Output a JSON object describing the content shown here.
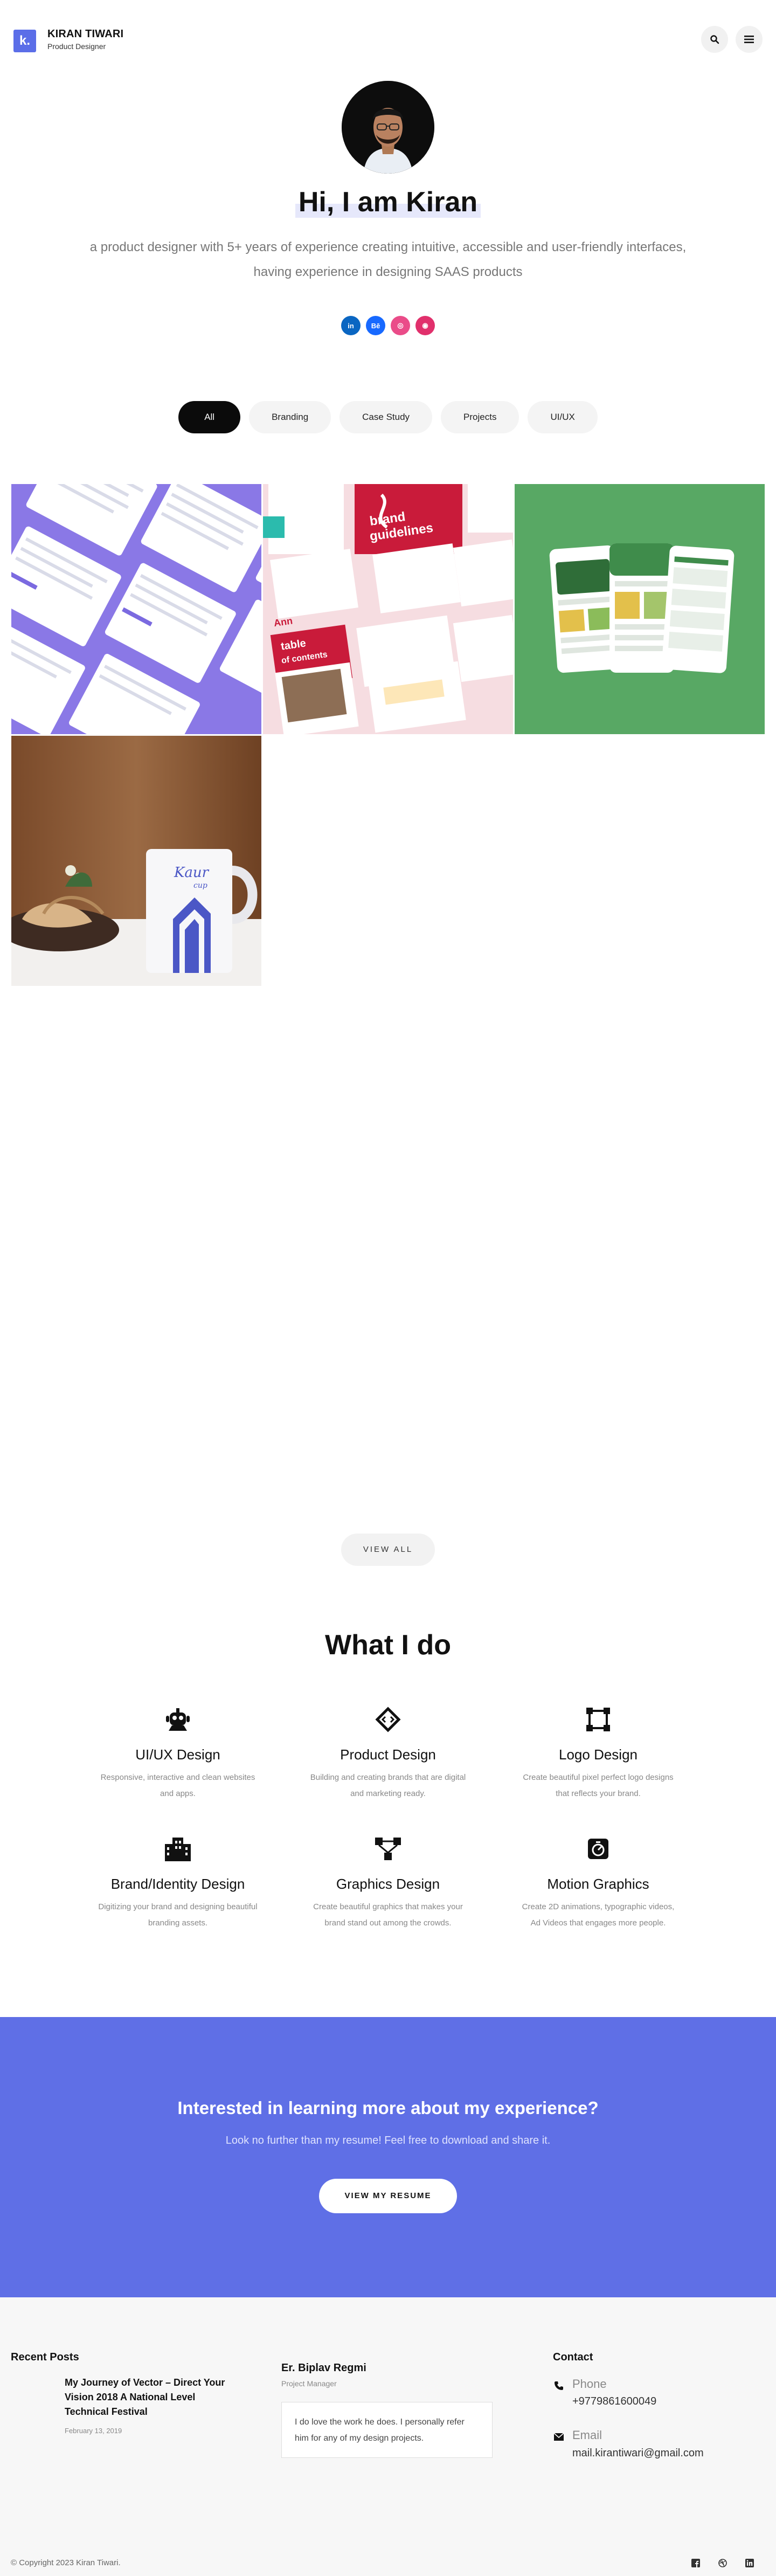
{
  "header": {
    "logo": "k.",
    "name": "KIRAN TIWARI",
    "role": "Product Designer"
  },
  "hero": {
    "title": "Hi, I am Kiran",
    "description": "a product designer with 5+ years of experience creating intuitive, accessible and user-friendly interfaces, having experience in designing SAAS products",
    "socials": [
      {
        "icon": "linkedin-icon",
        "label": "in"
      },
      {
        "icon": "behance-icon",
        "label": "Bē"
      },
      {
        "icon": "dribbble-icon",
        "label": "◎"
      },
      {
        "icon": "instagram-icon",
        "label": "◉"
      }
    ]
  },
  "filters": [
    "All",
    "Branding",
    "Case Study",
    "Projects",
    "UI/UX"
  ],
  "gallery": {
    "brand_cover_line1": "brand",
    "brand_cover_line2": "guidelines",
    "brand_toc_line1": "table",
    "brand_toc_line2": "of contents",
    "brand_logo_text": "Ann",
    "mug_script": "Kaur",
    "mug_sub": "cup"
  },
  "view_all": "VIEW ALL",
  "what_i_do": {
    "title": "What I do",
    "services": [
      {
        "icon": "bot-icon",
        "title": "UI/UX Design",
        "desc": "Responsive, interactive and clean websites and apps."
      },
      {
        "icon": "diamond-code-icon",
        "title": "Product Design",
        "desc": "Building and creating brands that are digital and marketing ready."
      },
      {
        "icon": "vector-square-icon",
        "title": "Logo Design",
        "desc": "Create beautiful pixel perfect logo designs that reflects your brand."
      },
      {
        "icon": "building-icon",
        "title": "Brand/Identity Design",
        "desc": "Digitizing your brand and designing beautiful branding assets."
      },
      {
        "icon": "nodes-icon",
        "title": "Graphics Design",
        "desc": "Create beautiful graphics that makes your brand stand out among the crowds."
      },
      {
        "icon": "motion-icon",
        "title": "Motion Graphics",
        "desc": "Create 2D animations, typographic videos, Ad Videos that engages more people."
      }
    ]
  },
  "cta": {
    "title": "Interested in learning more about my experience?",
    "subtitle": "Look no further than my resume! Feel free to download and share it.",
    "button": "VIEW MY RESUME"
  },
  "footer": {
    "recent_posts_title": "Recent Posts",
    "post_title": "My Journey of Vector – Direct Your Vision 2018 A National Level Technical Festival",
    "post_date": "February 13, 2019",
    "testimonial_name": "Er. Biplav Regmi",
    "testimonial_role": "Project Manager",
    "testimonial_text": "I do love the work he does. I personally refer him for any of my design projects.",
    "contact_title": "Contact",
    "phone_label": "Phone",
    "phone_value": "+9779861600049",
    "email_label": "Email",
    "email_value": "mail.kirantiwari@gmail.com",
    "copyright": "© Copyright 2023 Kiran Tiwari."
  },
  "colors": {
    "accent": "#5f6fe6",
    "dark": "#0b0b0b"
  }
}
